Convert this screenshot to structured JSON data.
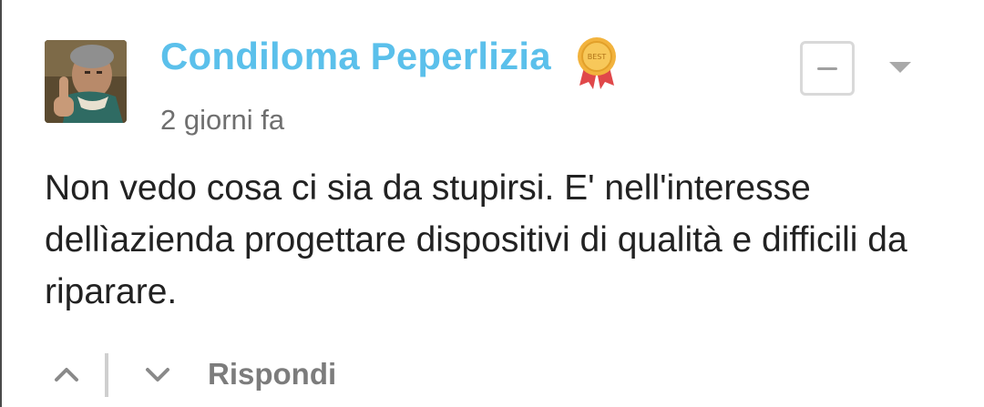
{
  "comment": {
    "author": "Condiloma Peperlizia",
    "badge_text": "BEST",
    "timestamp": "2 giorni fa",
    "text": "Non vedo cosa ci sia da stupirsi. E' nell'interesse dellìazienda progettare dispositivi di qualità e difficili da riparare.",
    "collapse_symbol": "−",
    "reply_label": "Rispondi"
  },
  "icons": {
    "avatar": "user-avatar",
    "badge": "best-award-medal-icon",
    "collapse": "minus-icon",
    "menu": "caret-down-icon",
    "upvote": "chevron-up-icon",
    "downvote": "chevron-down-icon"
  },
  "colors": {
    "author": "#5bc0eb",
    "text": "#222222",
    "muted": "#6f6f6f",
    "badge_gold": "#f2b33d",
    "badge_ribbon": "#e0484a"
  }
}
